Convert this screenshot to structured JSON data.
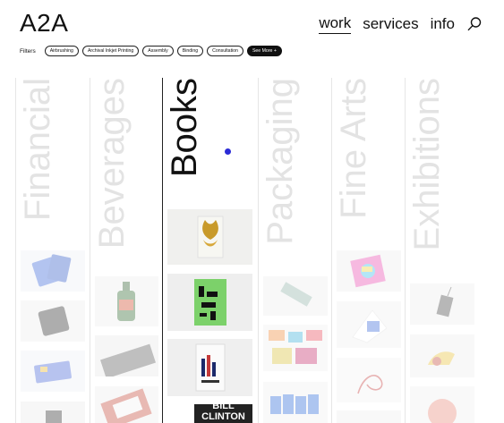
{
  "header": {
    "logo": "A2A",
    "nav": [
      {
        "label": "work",
        "active": true
      },
      {
        "label": "services",
        "active": false
      },
      {
        "label": "info",
        "active": false
      }
    ]
  },
  "filters": {
    "label": "Filters",
    "chips": [
      "Airbrushing",
      "Archival Inkjet Printing",
      "Assembly",
      "Binding",
      "Consultation"
    ],
    "more": "See More +"
  },
  "categories": [
    {
      "name": "Financial",
      "state": "faded"
    },
    {
      "name": "Beverages",
      "state": "faded"
    },
    {
      "name": "Books",
      "state": "active"
    },
    {
      "name": "Packaging",
      "state": "faded"
    },
    {
      "name": "Fine Arts",
      "state": "faded"
    },
    {
      "name": "Exhibitions",
      "state": "faded"
    }
  ],
  "book_cards": {
    "last_label": "BILL CLINTON"
  },
  "colors": {
    "accent_dot": "#2b2bd6",
    "text": "#111111",
    "faded_title": "#e3e3e3"
  }
}
